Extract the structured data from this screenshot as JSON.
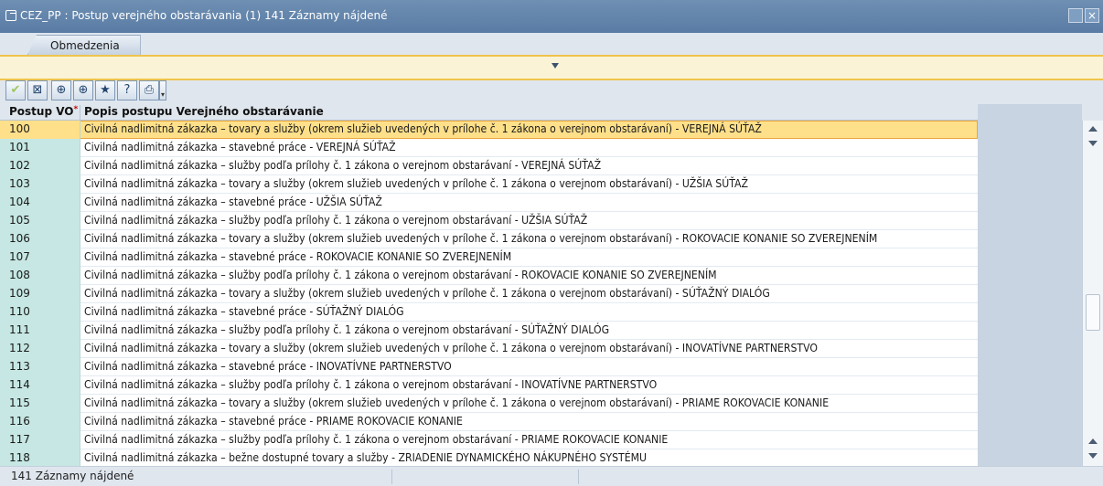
{
  "window": {
    "title": "CEZ_PP : Postup verejného obstarávania (1)  141 Záznamy nájdené",
    "close_glyph": "×"
  },
  "tabs": [
    "Obmedzenia"
  ],
  "toolbar": {
    "icons": [
      "check-icon",
      "cancel-icon",
      "find-icon",
      "find-next-icon",
      "favorites-icon",
      "help-icon",
      "print-icon",
      "dropdown-icon"
    ],
    "glyphs": [
      "✔",
      "⊠",
      "⊕",
      "⊕",
      "★",
      "?",
      "⎙",
      "▾"
    ]
  },
  "grid": {
    "headers": {
      "code": "Postup VO",
      "required_mark": "*",
      "description": "Popis postupu Verejného obstarávanie"
    },
    "rows": [
      {
        "code": "100",
        "description": "Civilná nadlimitná zákazka – tovary a služby (okrem služieb uvedených v prílohe č. 1 zákona o verejnom obstarávaní) - VEREJNÁ SÚŤAŽ",
        "selected": true
      },
      {
        "code": "101",
        "description": "Civilná nadlimitná zákazka – stavebné práce - VEREJNÁ SÚŤAŽ"
      },
      {
        "code": "102",
        "description": "Civilná nadlimitná zákazka – služby podľa prílohy č. 1 zákona o verejnom obstarávaní - VEREJNÁ SÚŤAŽ"
      },
      {
        "code": "103",
        "description": "Civilná nadlimitná zákazka – tovary a služby (okrem služieb uvedených v prílohe č. 1 zákona o verejnom obstarávaní) - UŽŠIA SÚŤAŽ"
      },
      {
        "code": "104",
        "description": "Civilná nadlimitná zákazka – stavebné práce - UŽŠIA SÚŤAŽ"
      },
      {
        "code": "105",
        "description": "Civilná nadlimitná zákazka – služby podľa prílohy č. 1 zákona o verejnom obstarávaní - UŽŠIA SÚŤAŽ"
      },
      {
        "code": "106",
        "description": "Civilná nadlimitná zákazka – tovary a služby (okrem služieb uvedených v prílohe č. 1 zákona o verejnom obstarávaní) - ROKOVACIE KONANIE SO ZVEREJNENÍM"
      },
      {
        "code": "107",
        "description": "Civilná nadlimitná zákazka – stavebné práce - ROKOVACIE KONANIE SO ZVEREJNENÍM"
      },
      {
        "code": "108",
        "description": "Civilná nadlimitná zákazka – služby podľa prílohy č. 1 zákona o verejnom obstarávaní - ROKOVACIE KONANIE SO ZVEREJNENÍM"
      },
      {
        "code": "109",
        "description": "Civilná nadlimitná zákazka – tovary a služby (okrem služieb uvedených v prílohe č. 1 zákona o verejnom obstarávaní) - SÚŤAŽNÝ DIALÓG"
      },
      {
        "code": "110",
        "description": "Civilná nadlimitná zákazka – stavebné práce - SÚŤAŽNÝ DIALÓG"
      },
      {
        "code": "111",
        "description": "Civilná nadlimitná zákazka – služby podľa prílohy č. 1 zákona o verejnom obstarávaní - SÚŤAŽNÝ DIALÓG"
      },
      {
        "code": "112",
        "description": "Civilná nadlimitná zákazka – tovary a služby (okrem služieb uvedených v prílohe č. 1 zákona o verejnom obstarávaní) - INOVATÍVNE PARTNERSTVO"
      },
      {
        "code": "113",
        "description": "Civilná nadlimitná zákazka – stavebné práce - INOVATÍVNE PARTNERSTVO"
      },
      {
        "code": "114",
        "description": "Civilná nadlimitná zákazka – služby podľa prílohy č. 1 zákona o verejnom obstarávaní - INOVATÍVNE PARTNERSTVO"
      },
      {
        "code": "115",
        "description": "Civilná nadlimitná zákazka – tovary a služby (okrem služieb uvedených v prílohe č. 1 zákona o verejnom obstarávaní) - PRIAME ROKOVACIE KONANIE"
      },
      {
        "code": "116",
        "description": "Civilná nadlimitná zákazka – stavebné práce - PRIAME ROKOVACIE KONANIE"
      },
      {
        "code": "117",
        "description": "Civilná nadlimitná zákazka – služby podľa prílohy č. 1 zákona o verejnom obstarávaní - PRIAME ROKOVACIE KONANIE"
      },
      {
        "code": "118",
        "description": "Civilná nadlimitná zákazka – bežne dostupné tovary a služby - ZRIADENIE DYNAMICKÉHO NÁKUPNÉHO SYSTÉMU"
      }
    ]
  },
  "status": {
    "text": "141 Záznamy nájdené"
  },
  "colors": {
    "key_column": "#c6e7e3",
    "selected_row": "#ffe08a",
    "restriction_bar": "#fbf3d6",
    "titlebar": "#5a7ca4"
  }
}
